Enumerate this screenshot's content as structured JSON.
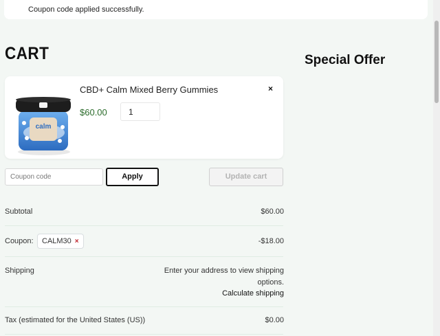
{
  "notice": {
    "message": "Coupon code applied successfully."
  },
  "cart": {
    "title": "CART",
    "item": {
      "name": "CBD+ Calm Mixed Berry Gummies",
      "price": "$60.00",
      "quantity": "1",
      "remove_glyph": "×"
    },
    "coupon_placeholder": "Coupon code",
    "apply_label": "Apply",
    "update_label": "Update cart"
  },
  "sidebar": {
    "special_offer_title": "Special Offer"
  },
  "totals": {
    "subtotal_label": "Subtotal",
    "subtotal_value": "$60.00",
    "coupon_label": "Coupon:",
    "coupon_code": "CALM30",
    "coupon_remove_glyph": "×",
    "coupon_value": "-$18.00",
    "shipping_label": "Shipping",
    "shipping_text": "Enter your address to view shipping options.",
    "calculate_shipping": "Calculate shipping",
    "tax_label": "Tax (estimated for the United States (US))",
    "tax_value": "$0.00"
  },
  "colors": {
    "price": "#2b6b2b",
    "coupon_remove": "#c0262d",
    "background": "#f3f7f4"
  },
  "product_image_icon": "gummies-jar-icon"
}
